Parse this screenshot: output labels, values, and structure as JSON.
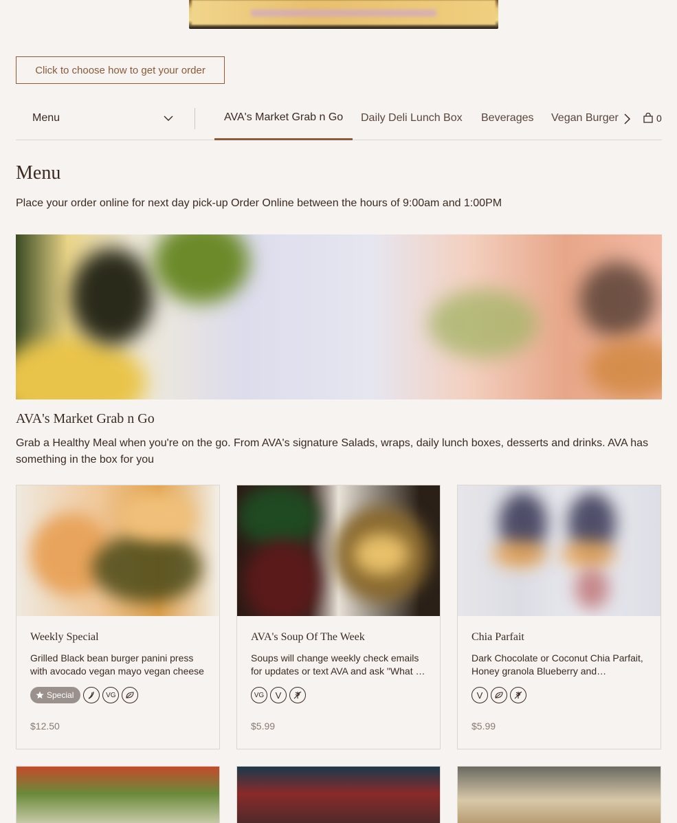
{
  "order_button": {
    "label": "Click to choose how to get your order"
  },
  "nav": {
    "menu_select": "Menu",
    "tabs": [
      {
        "label": "AVA's Market Grab n Go",
        "active": true
      },
      {
        "label": "Daily Deli Lunch Box"
      },
      {
        "label": "Beverages"
      },
      {
        "label": "Vegan Burger"
      }
    ],
    "cart_count": "0"
  },
  "page": {
    "title": "Menu",
    "subtitle": "Place your order online for next day pick-up Order Online between the hours of 9:00am and 1:00PM"
  },
  "section": {
    "title": "AVA's Market Grab n Go",
    "description": "Grab a Healthy Meal when you're on the go. From AVA's signature Salads, wraps, daily lunch boxes, desserts and drinks. AVA has something in the box for you"
  },
  "items": [
    {
      "title": "Weekly Special",
      "description": "Grilled Black bean burger panini press with avocado vegan mayo vegan cheese …",
      "special_label": "Special",
      "diet_icons": [
        "spicy-icon",
        "vegan-icon",
        "organic-icon"
      ],
      "price": "$12.50"
    },
    {
      "title": "AVA's Soup Of The Week",
      "description": "Soups will change weekly check emails for updates or text AVA and ask \"What …",
      "diet_icons": [
        "vegan-icon",
        "vegetarian-icon",
        "gluten-free-icon"
      ],
      "price": "$5.99"
    },
    {
      "title": "Chia Parfait",
      "description": "Dark Chocolate or Coconut Chia Parfait, Honey granola Blueberry and…",
      "diet_icons": [
        "vegetarian-icon",
        "organic-icon",
        "gluten-free-icon"
      ],
      "price": "$5.99"
    }
  ],
  "colors": {
    "accent": "#8a5a3a",
    "background": "#f6f3f0",
    "text": "#3b2a22"
  }
}
